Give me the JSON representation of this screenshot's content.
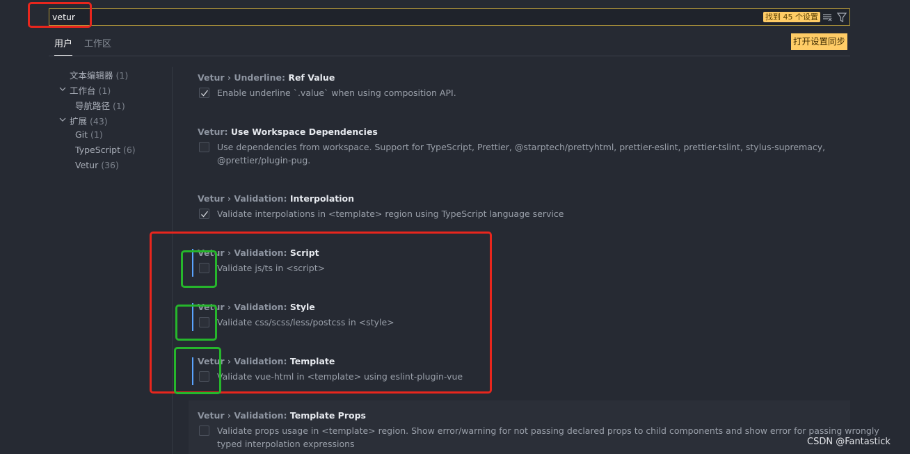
{
  "search": {
    "value": "vetur",
    "result_count": "找到 45 个设置",
    "clear_icon": "clear-filter-icon",
    "filter_icon": "filter-funnel-icon"
  },
  "tabs": [
    {
      "label": "用户",
      "active": true
    },
    {
      "label": "工作区",
      "active": false
    }
  ],
  "sync_button": "打开设置同步",
  "sidebar": {
    "items": [
      {
        "label": "文本编辑器",
        "count": "(1)"
      },
      {
        "label": "工作台",
        "count": "(1)"
      },
      {
        "label": "导航路径",
        "count": "(1)"
      },
      {
        "label": "扩展",
        "count": "(43)"
      },
      {
        "label": "Git",
        "count": "(1)"
      },
      {
        "label": "TypeScript",
        "count": "(6)"
      },
      {
        "label": "Vetur",
        "count": "(36)"
      }
    ]
  },
  "settings": [
    {
      "prefix": "Vetur › Underline: ",
      "name": "Ref Value",
      "desc": [
        "Enable underline `.value` when using composition API."
      ],
      "checked": true,
      "modified": false
    },
    {
      "prefix": "Vetur: ",
      "name": "Use Workspace Dependencies",
      "desc": [
        "Use dependencies from workspace. Support for TypeScript, Prettier, @starptech/prettyhtml, prettier-eslint, prettier-tslint, stylus-supremacy,",
        "@prettier/plugin-pug."
      ],
      "checked": false,
      "modified": false
    },
    {
      "prefix": "Vetur › Validation: ",
      "name": "Interpolation",
      "desc": [
        "Validate interpolations in <template> region using TypeScript language service"
      ],
      "checked": true,
      "modified": false
    },
    {
      "prefix": "Vetur › Validation: ",
      "name": "Script",
      "desc": [
        "Validate js/ts in <script>"
      ],
      "checked": false,
      "modified": true
    },
    {
      "prefix": "Vetur › Validation: ",
      "name": "Style",
      "desc": [
        "Validate css/scss/less/postcss in <style>"
      ],
      "checked": false,
      "modified": true
    },
    {
      "prefix": "Vetur › Validation: ",
      "name": "Template",
      "desc": [
        "Validate vue-html in <template> using eslint-plugin-vue"
      ],
      "checked": false,
      "modified": true
    },
    {
      "prefix": "Vetur › Validation: ",
      "name": "Template Props",
      "desc": [
        "Validate props usage in <template> region. Show error/warning for not passing declared props to child components and show error for passing wrongly",
        "typed interpolation expressions"
      ],
      "checked": false,
      "modified": false
    }
  ],
  "watermark": "CSDN @Fantastick",
  "colors": {
    "background": "#262a33",
    "accent_yellow": "#ffcc66",
    "modified_indicator": "#5aa4ff",
    "annotation_red": "#e8261d",
    "annotation_green": "#26b62c"
  }
}
